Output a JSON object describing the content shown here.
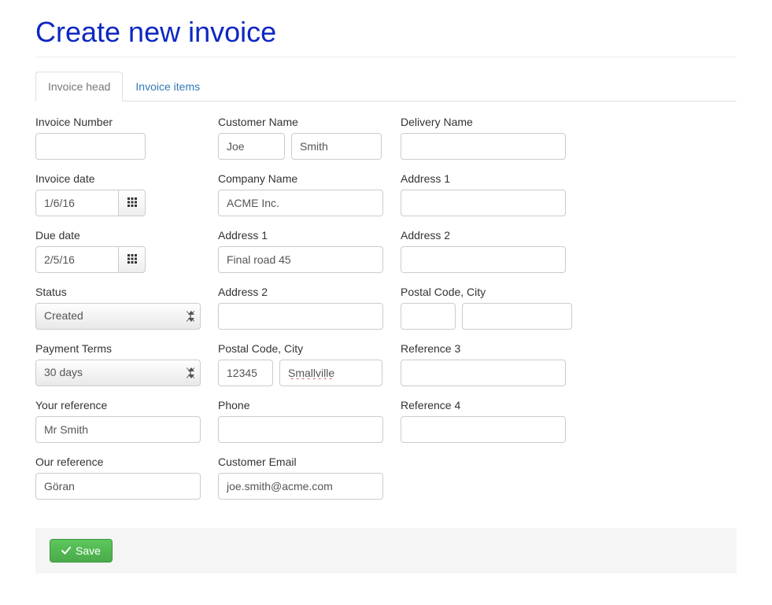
{
  "page": {
    "title": "Create new invoice"
  },
  "tabs": {
    "head": "Invoice head",
    "items": "Invoice items"
  },
  "col1": {
    "invoice_number": {
      "label": "Invoice Number",
      "value": ""
    },
    "invoice_date": {
      "label": "Invoice date",
      "value": "1/6/16"
    },
    "due_date": {
      "label": "Due date",
      "value": "2/5/16"
    },
    "status": {
      "label": "Status",
      "value": "Created"
    },
    "payment_terms": {
      "label": "Payment Terms",
      "value": "30 days"
    },
    "your_ref": {
      "label": "Your reference",
      "value": "Mr Smith"
    },
    "our_ref": {
      "label": "Our reference",
      "value": "Göran"
    }
  },
  "col2": {
    "customer_name": {
      "label": "Customer Name",
      "first": "Joe",
      "last": "Smith"
    },
    "company": {
      "label": "Company Name",
      "value": "ACME Inc."
    },
    "address1": {
      "label": "Address 1",
      "value": "Final road 45"
    },
    "address2": {
      "label": "Address 2",
      "value": ""
    },
    "postal": {
      "label": "Postal Code, City",
      "code": "12345",
      "city": "Smallville"
    },
    "phone": {
      "label": "Phone",
      "value": ""
    },
    "email": {
      "label": "Customer Email",
      "value": "joe.smith@acme.com"
    }
  },
  "col3": {
    "delivery_name": {
      "label": "Delivery Name",
      "value": ""
    },
    "address1": {
      "label": "Address 1",
      "value": ""
    },
    "address2": {
      "label": "Address 2",
      "value": ""
    },
    "postal": {
      "label": "Postal Code, City",
      "code": "",
      "city": ""
    },
    "ref3": {
      "label": "Reference 3",
      "value": ""
    },
    "ref4": {
      "label": "Reference 4",
      "value": ""
    }
  },
  "footer": {
    "save": "Save"
  }
}
